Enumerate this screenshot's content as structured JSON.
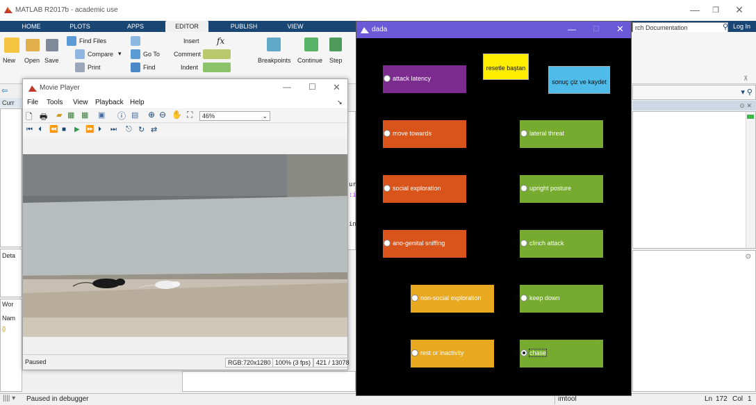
{
  "matlab": {
    "title": "MATLAB R2017b - academic use",
    "tabs": [
      "HOME",
      "PLOTS",
      "APPS",
      "EDITOR",
      "PUBLISH",
      "VIEW"
    ],
    "active_tab": "EDITOR",
    "search_placeholder": "rch Documentation",
    "login": "Log In",
    "ribbon": {
      "new": "New",
      "open": "Open",
      "save": "Save",
      "find_files": "Find Files",
      "compare": "Compare",
      "print": "Print",
      "go_to": "Go To",
      "find": "Find",
      "insert": "Insert",
      "comment": "Comment",
      "indent": "Indent",
      "breakpoints": "Breakpoints",
      "continue": "Continue",
      "step": "Step"
    },
    "panels": {
      "current_folder_short": "Curr",
      "details_short": "Deta",
      "workspace_short": "Wor",
      "name_short": "Nam"
    },
    "editor_fragments": [
      "ur",
      ":i",
      "in"
    ],
    "status": {
      "left": "Paused in debugger",
      "tool": "imtool",
      "ln_label": "Ln",
      "ln": "172",
      "col_label": "Col",
      "col": "1"
    }
  },
  "movie_player": {
    "title": "Movie Player",
    "menu": [
      "File",
      "Tools",
      "View",
      "Playback",
      "Help"
    ],
    "zoom": "46%",
    "status": "Paused",
    "rgb": "RGB:720x1280",
    "speed": "100% (3 fps)",
    "frame": "421 / 13078"
  },
  "dada": {
    "title": "dada",
    "reset_button": "resetle baştan",
    "save_button": "sonuç çiz ve kaydet",
    "behaviors": [
      {
        "label": "attack latency",
        "color": "#7b2c8e"
      },
      {
        "label": "move towards",
        "color": "#d9541a"
      },
      {
        "label": "social exploration",
        "color": "#d9541a"
      },
      {
        "label": "ano-genital sniffing",
        "color": "#d9541a"
      },
      {
        "label": "non-social exploration",
        "color": "#e8a820"
      },
      {
        "label": "rest or inactivity",
        "color": "#e8a820"
      },
      {
        "label": "lateral threat",
        "color": "#77ab2f"
      },
      {
        "label": "upright posture",
        "color": "#77ab2f"
      },
      {
        "label": "clinch attack",
        "color": "#77ab2f"
      },
      {
        "label": "keep down",
        "color": "#77ab2f"
      },
      {
        "label": "chase",
        "color": "#77ab2f"
      }
    ]
  }
}
